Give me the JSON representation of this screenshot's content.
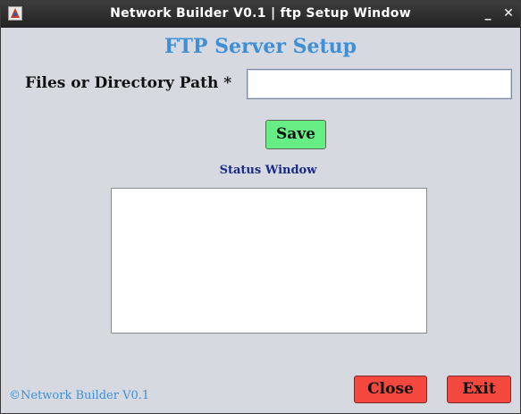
{
  "window": {
    "title": "Network Builder V0.1 | ftp Setup Window",
    "minimize_glyph": "_",
    "close_glyph": "✕"
  },
  "form": {
    "heading": "FTP Server Setup",
    "path_label": "Files or Directory Path *",
    "path_value": "",
    "save_label": "Save"
  },
  "status": {
    "label": "Status Window",
    "content": ""
  },
  "footer": {
    "copyright": "©Network Builder V0.1",
    "close_label": "Close",
    "exit_label": "Exit"
  },
  "colors": {
    "heading": "#3f8fd6",
    "save_button": "#66ee85",
    "danger_button": "#f4473d",
    "status_label": "#1a2a8a",
    "window_bg": "#d6d9df"
  },
  "icons": {
    "app": "app-icon",
    "minimize": "minimize-icon",
    "close": "close-icon"
  }
}
